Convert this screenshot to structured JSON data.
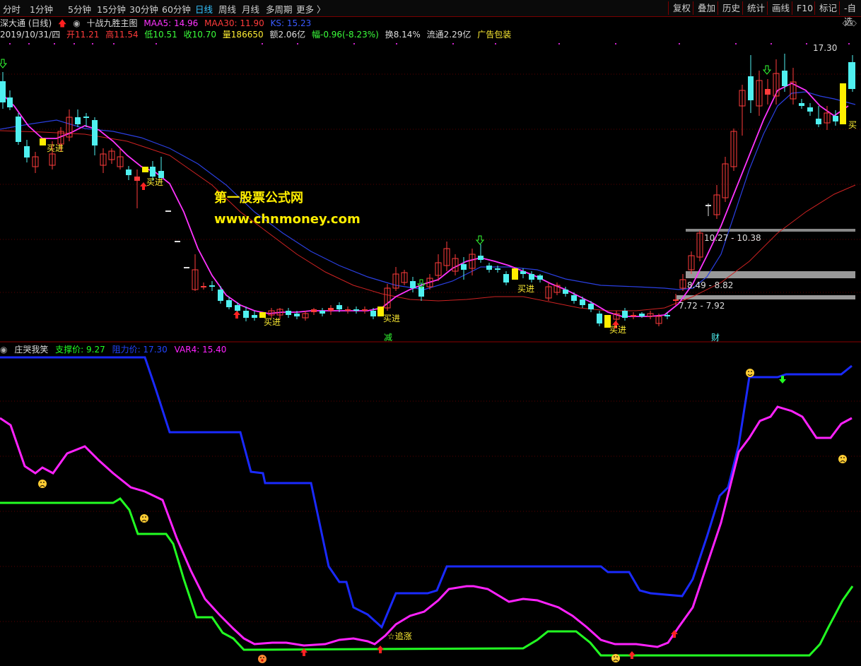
{
  "toolbar": {
    "periods": [
      "分时",
      "1分钟",
      "5分钟",
      "15分钟",
      "30分钟",
      "60分钟",
      "日线",
      "周线",
      "月线",
      "多周期",
      "更多 〉"
    ],
    "active_period": "日线",
    "right_buttons": [
      "复权",
      "叠加",
      "历史",
      "统计",
      "画线",
      "F10",
      "标记",
      "-自选"
    ]
  },
  "header": {
    "stock": "深大通 (日线)",
    "indicator": "十战九胜主图",
    "maa5": "MAA5: 14.96",
    "maa30": "MAA30: 11.90",
    "ks": "KS: 15.23",
    "date": "2019/10/31/四",
    "open": "开11.21",
    "high": "高11.54",
    "low": "低10.51",
    "close": "收10.70",
    "volume": "量186650",
    "amount": "额2.06亿",
    "range": "幅-0.96(-8.23%)",
    "turnover": "换8.14%",
    "float": "流通2.29亿",
    "ad": "广告包装",
    "corner": "◇ ◇"
  },
  "watermark": {
    "title": "第一股票公式网",
    "url": "www.chnmoney.com"
  },
  "main_labels": {
    "buy": "买进",
    "buy_sell": "买进",
    "reduce": "减",
    "finance": "财",
    "price_1730": "17.30",
    "range_a": "10.27 - 10.38",
    "range_b": "8.49 - 8.82",
    "range_c": "7.72 - 7.92",
    "edge_buy": "买"
  },
  "indicator": {
    "name": "庄哭我笑",
    "support": "支撑价: 9.27",
    "resistance": "阻力价: 17.30",
    "var4": "VAR4: 15.40",
    "chase_label": "☆追涨"
  },
  "colors": {
    "up": "#ff3b3b",
    "down": "#4ff0f0",
    "maa5": "#ff33ff",
    "maa30": "#2a3fe0",
    "support": "#22ff22",
    "resistance": "#1a2aff",
    "var4": "#ff22ff",
    "buy_label": "#ffee33",
    "highlight": "#ffee00"
  }
}
